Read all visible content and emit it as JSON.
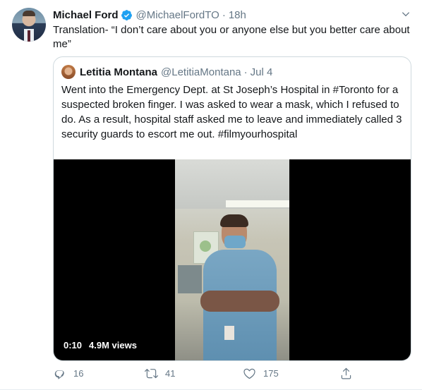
{
  "tweet": {
    "author_name": "Michael Ford",
    "author_handle": "@MichaelFordTO",
    "time": "18h",
    "separator": "·",
    "text": "Translation- “I don’t care about you or anyone else but you better care about me”"
  },
  "quote": {
    "author_name": "Letitia Montana",
    "author_handle": "@LetitiaMontana",
    "separator": "·",
    "date": "Jul 4",
    "text": "Went into the Emergency Dept. at St Joseph’s Hospital in #Toronto for a suspected broken finger. I was asked to wear a mask, which I refused to do. As a result, hospital staff asked me to leave and immediately called 3 security guards to escort me out. #filmyourhospital",
    "video": {
      "duration": "0:10",
      "views": "4.9M views"
    }
  },
  "actions": {
    "reply_count": "16",
    "retweet_count": "41",
    "like_count": "175"
  },
  "icons": {
    "verified": "verified-badge-icon",
    "more": "chevron-down-icon",
    "reply": "reply-icon",
    "retweet": "retweet-icon",
    "like": "heart-icon",
    "share": "share-icon"
  },
  "colors": {
    "text": "#14171a",
    "muted": "#657786",
    "verified": "#1da1f2",
    "border": "#cfd9de"
  }
}
